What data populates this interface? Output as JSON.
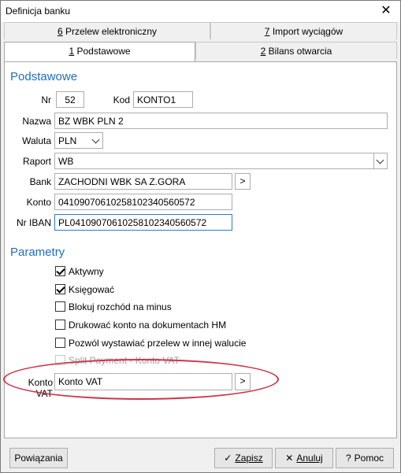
{
  "window": {
    "title": "Definicja banku",
    "close_symbol": "✕"
  },
  "tabs_top": [
    {
      "hotkey": "6",
      "label": " Przelew elektroniczny"
    },
    {
      "hotkey": "7",
      "label": " Import wyciągów"
    }
  ],
  "tabs_bottom": [
    {
      "hotkey": "1",
      "label": " Podstawowe",
      "active": true
    },
    {
      "hotkey": "2",
      "label": " Bilans otwarcia",
      "active": false
    }
  ],
  "podstawowe": {
    "heading": "Podstawowe",
    "nr_label": "Nr",
    "nr_value": "52",
    "kod_label": "Kod",
    "kod_value": "KONTO1",
    "nazwa_label": "Nazwa",
    "nazwa_value": "BZ WBK PLN 2",
    "waluta_label": "Waluta",
    "waluta_value": "PLN",
    "raport_label": "Raport",
    "raport_value": "WB",
    "bank_label": "Bank",
    "bank_value": "ZACHODNI WBK SA Z.GORA",
    "konto_label": "Konto",
    "konto_value": "04109070610258102340560572",
    "iban_label": "Nr IBAN",
    "iban_value": "PL04109070610258102340560572",
    "more_symbol": ">"
  },
  "parametry": {
    "heading": "Parametry",
    "checkboxes": [
      {
        "label": "Aktywny",
        "checked": true,
        "enabled": true
      },
      {
        "label": "Księgować",
        "checked": true,
        "enabled": true
      },
      {
        "label": "Blokuj rozchód na minus",
        "checked": false,
        "enabled": true
      },
      {
        "label": "Drukować konto na dokumentach HM",
        "checked": false,
        "enabled": true
      },
      {
        "label": "Pozwól wystawiać przelew w innej walucie",
        "checked": false,
        "enabled": true
      },
      {
        "label": "Split Payment - Konto VAT",
        "checked": false,
        "enabled": false
      }
    ],
    "konto_vat_label": "Konto VAT",
    "konto_vat_value": "Konto VAT"
  },
  "footer": {
    "powiazania_label": "Powiązania",
    "zapisz_label": "Zapisz",
    "anuluj_label": "Anuluj",
    "pomoc_label": "Pomoc"
  },
  "colors": {
    "accent": "#1e6ebf",
    "highlight_ellipse": "#d0344a",
    "focus_border": "#2b7bd3"
  }
}
